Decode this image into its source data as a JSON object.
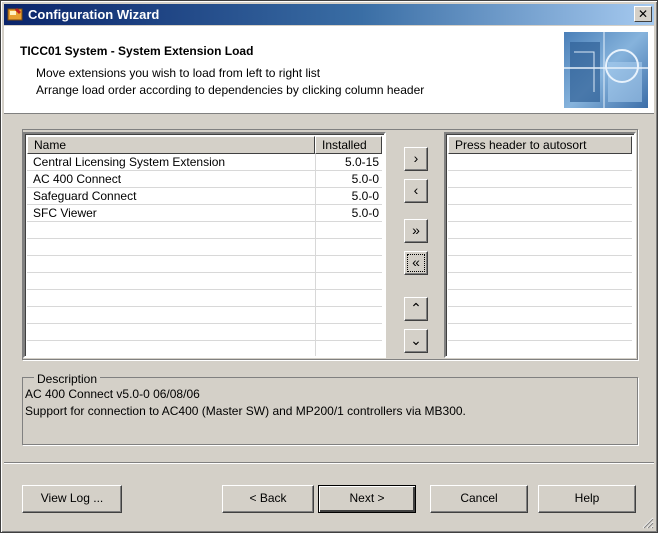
{
  "window": {
    "title": "Configuration Wizard",
    "close_glyph": "✕"
  },
  "header": {
    "title": "TICC01 System - System Extension Load",
    "line1": "Move extensions you wish to load from left to right list",
    "line2": "Arrange load order according to dependencies by clicking column header"
  },
  "available_list": {
    "columns": [
      "Name",
      "Installed"
    ],
    "rows": [
      {
        "name": "Central Licensing System Extension",
        "installed": "5.0-15"
      },
      {
        "name": "AC 400 Connect",
        "installed": "5.0-0"
      },
      {
        "name": "Safeguard Connect",
        "installed": "5.0-0"
      },
      {
        "name": "SFC Viewer",
        "installed": "5.0-0"
      }
    ],
    "empty_rows": 7
  },
  "load_list": {
    "header": "Press header to autosort",
    "empty_rows": 11
  },
  "arrows": {
    "add": "›",
    "remove": "‹",
    "add_all": "»",
    "remove_all": "«",
    "up": "⌃",
    "down": "⌄"
  },
  "description": {
    "legend": "Description",
    "line1": "AC 400 Connect v5.0-0 06/08/06",
    "line2": "Support for connection to AC400 (Master SW) and MP200/1 controllers via MB300."
  },
  "buttons": {
    "view_log": "View Log ...",
    "back": "< Back",
    "next": "Next >",
    "cancel": "Cancel",
    "help": "Help"
  }
}
